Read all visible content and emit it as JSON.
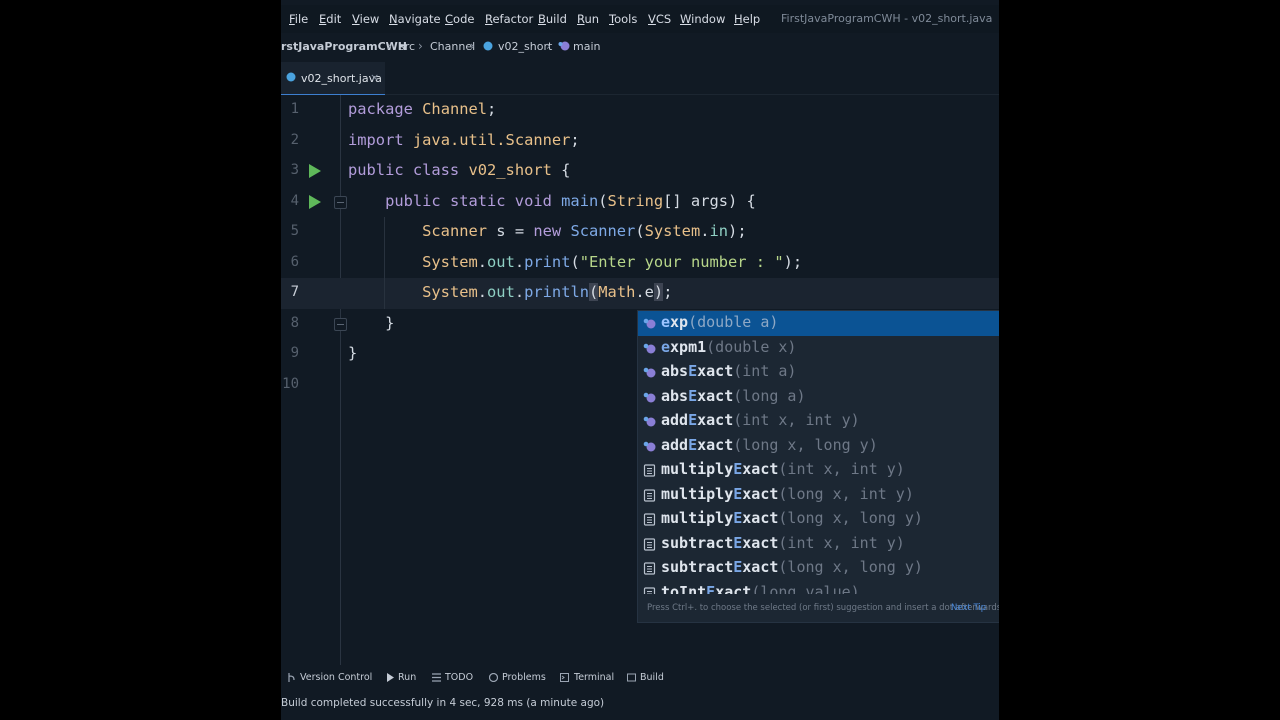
{
  "menu": {
    "items": [
      "File",
      "Edit",
      "View",
      "Navigate",
      "Code",
      "Refactor",
      "Build",
      "Run",
      "Tools",
      "VCS",
      "Window",
      "Help"
    ],
    "window_title": "FirstJavaProgramCWH - v02_short.java"
  },
  "breadcrumb": {
    "project": "rstJavaProgramCWH",
    "src": "src",
    "package": "Channel",
    "file": "v02_short",
    "method": "main"
  },
  "tab": {
    "label": "v02_short.java",
    "close": "×"
  },
  "editor": {
    "lines": [
      {
        "n": "1"
      },
      {
        "n": "2"
      },
      {
        "n": "3"
      },
      {
        "n": "4"
      },
      {
        "n": "5"
      },
      {
        "n": "6"
      },
      {
        "n": "7"
      },
      {
        "n": "8"
      },
      {
        "n": "9"
      },
      {
        "n": "10"
      }
    ]
  },
  "completion": {
    "items": [
      {
        "pre": "",
        "hl": "e",
        "post": "xp",
        "params": "(double a)"
      },
      {
        "pre": "",
        "hl": "e",
        "post": "xpm1",
        "params": "(double x)"
      },
      {
        "pre": "abs",
        "hl": "E",
        "post": "xact",
        "params": "(int a)"
      },
      {
        "pre": "abs",
        "hl": "E",
        "post": "xact",
        "params": "(long a)"
      },
      {
        "pre": "add",
        "hl": "E",
        "post": "xact",
        "params": "(int x, int y)"
      },
      {
        "pre": "add",
        "hl": "E",
        "post": "xact",
        "params": "(long x, long y)"
      },
      {
        "pre": "multiply",
        "hl": "E",
        "post": "xact",
        "params": "(int x, int y)"
      },
      {
        "pre": "multiply",
        "hl": "E",
        "post": "xact",
        "params": "(long x, int y)"
      },
      {
        "pre": "multiply",
        "hl": "E",
        "post": "xact",
        "params": "(long x, long y)"
      },
      {
        "pre": "subtract",
        "hl": "E",
        "post": "xact",
        "params": "(int x, int y)"
      },
      {
        "pre": "subtract",
        "hl": "E",
        "post": "xact",
        "params": "(long x, long y)"
      },
      {
        "pre": "toInt",
        "hl": "E",
        "post": "xact",
        "params": "(long value)"
      }
    ],
    "hint": "Press Ctrl+. to choose the selected (or first) suggestion and insert a dot afterwards",
    "next_tip": "Next Tip"
  },
  "toolwindows": [
    "Version Control",
    "Run",
    "TODO",
    "Problems",
    "Terminal",
    "Build"
  ],
  "status": "Build completed successfully in 4 sec, 928 ms (a minute ago)"
}
